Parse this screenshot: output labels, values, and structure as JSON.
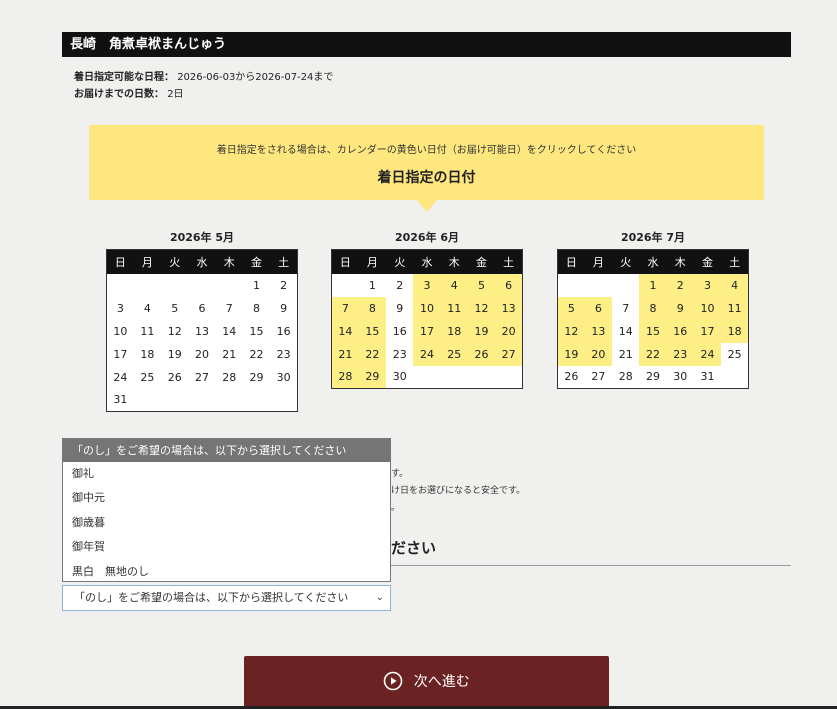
{
  "product_title": "長崎　角煮卓袱まんじゅう",
  "info": {
    "range_label": "着日指定可能な日程：",
    "range_value": "2026-06-03から2026-07-24まで",
    "days_label": "お届けまでの日数：",
    "days_value": "2日"
  },
  "banner": {
    "instruction": "着日指定をされる場合は、カレンダーの黄色い日付（お届け可能日）をクリックしてください",
    "heading": "着日指定の日付"
  },
  "weekday_headers": [
    "日",
    "月",
    "火",
    "水",
    "木",
    "金",
    "土"
  ],
  "calendars": [
    {
      "caption": "2026年 5月",
      "weeks": [
        [
          {
            "d": ""
          },
          {
            "d": ""
          },
          {
            "d": ""
          },
          {
            "d": ""
          },
          {
            "d": ""
          },
          {
            "d": "1"
          },
          {
            "d": "2"
          }
        ],
        [
          {
            "d": "3"
          },
          {
            "d": "4"
          },
          {
            "d": "5"
          },
          {
            "d": "6"
          },
          {
            "d": "7"
          },
          {
            "d": "8"
          },
          {
            "d": "9"
          }
        ],
        [
          {
            "d": "10"
          },
          {
            "d": "11"
          },
          {
            "d": "12"
          },
          {
            "d": "13"
          },
          {
            "d": "14"
          },
          {
            "d": "15"
          },
          {
            "d": "16"
          }
        ],
        [
          {
            "d": "17"
          },
          {
            "d": "18"
          },
          {
            "d": "19"
          },
          {
            "d": "20"
          },
          {
            "d": "21"
          },
          {
            "d": "22"
          },
          {
            "d": "23"
          }
        ],
        [
          {
            "d": "24"
          },
          {
            "d": "25"
          },
          {
            "d": "26"
          },
          {
            "d": "27"
          },
          {
            "d": "28"
          },
          {
            "d": "29"
          },
          {
            "d": "30"
          }
        ],
        [
          {
            "d": "31"
          },
          {
            "d": ""
          },
          {
            "d": ""
          },
          {
            "d": ""
          },
          {
            "d": ""
          },
          {
            "d": ""
          },
          {
            "d": ""
          }
        ]
      ]
    },
    {
      "caption": "2026年 6月",
      "weeks": [
        [
          {
            "d": ""
          },
          {
            "d": "1"
          },
          {
            "d": "2"
          },
          {
            "d": "3",
            "y": true
          },
          {
            "d": "4",
            "y": true
          },
          {
            "d": "5",
            "y": true
          },
          {
            "d": "6",
            "y": true
          }
        ],
        [
          {
            "d": "7",
            "y": true
          },
          {
            "d": "8",
            "y": true
          },
          {
            "d": "9"
          },
          {
            "d": "10",
            "y": true
          },
          {
            "d": "11",
            "y": true
          },
          {
            "d": "12",
            "y": true
          },
          {
            "d": "13",
            "y": true
          }
        ],
        [
          {
            "d": "14",
            "y": true
          },
          {
            "d": "15",
            "y": true
          },
          {
            "d": "16"
          },
          {
            "d": "17",
            "y": true
          },
          {
            "d": "18",
            "y": true
          },
          {
            "d": "19",
            "y": true
          },
          {
            "d": "20",
            "y": true
          }
        ],
        [
          {
            "d": "21",
            "y": true
          },
          {
            "d": "22",
            "y": true
          },
          {
            "d": "23"
          },
          {
            "d": "24",
            "y": true
          },
          {
            "d": "25",
            "y": true
          },
          {
            "d": "26",
            "y": true
          },
          {
            "d": "27",
            "y": true
          }
        ],
        [
          {
            "d": "28",
            "y": true
          },
          {
            "d": "29",
            "y": true
          },
          {
            "d": "30"
          },
          {
            "d": ""
          },
          {
            "d": ""
          },
          {
            "d": ""
          },
          {
            "d": ""
          }
        ]
      ]
    },
    {
      "caption": "2026年 7月",
      "weeks": [
        [
          {
            "d": ""
          },
          {
            "d": ""
          },
          {
            "d": ""
          },
          {
            "d": "1",
            "y": true
          },
          {
            "d": "2",
            "y": true
          },
          {
            "d": "3",
            "y": true
          },
          {
            "d": "4",
            "y": true
          }
        ],
        [
          {
            "d": "5",
            "y": true
          },
          {
            "d": "6",
            "y": true
          },
          {
            "d": "7"
          },
          {
            "d": "8",
            "y": true
          },
          {
            "d": "9",
            "y": true
          },
          {
            "d": "10",
            "y": true
          },
          {
            "d": "11",
            "y": true
          }
        ],
        [
          {
            "d": "12",
            "y": true
          },
          {
            "d": "13",
            "y": true
          },
          {
            "d": "14"
          },
          {
            "d": "15",
            "y": true
          },
          {
            "d": "16",
            "y": true
          },
          {
            "d": "17",
            "y": true
          },
          {
            "d": "18",
            "y": true
          }
        ],
        [
          {
            "d": "19",
            "y": true
          },
          {
            "d": "20",
            "y": true
          },
          {
            "d": "21"
          },
          {
            "d": "22",
            "y": true
          },
          {
            "d": "23",
            "y": true
          },
          {
            "d": "24",
            "y": true
          },
          {
            "d": "25"
          }
        ],
        [
          {
            "d": "26"
          },
          {
            "d": "27"
          },
          {
            "d": "28"
          },
          {
            "d": "29"
          },
          {
            "d": "30"
          },
          {
            "d": "31"
          },
          {
            "d": ""
          }
        ]
      ]
    }
  ],
  "noshi": {
    "placeholder": "「のし」をご希望の場合は、以下から選択してください",
    "options": [
      "御礼",
      "御中元",
      "御歳暮",
      "御年賀",
      "黒白　無地のし"
    ],
    "selected": "「のし」をご希望の場合は、以下から選択してください"
  },
  "partial_text": {
    "line1": "す。",
    "line2": "け日をお選びになると安全です。",
    "line3": "。",
    "heading": "ださい"
  },
  "next_button": {
    "label": "次へ進む",
    "icon": "play-circle-icon"
  },
  "colors": {
    "title_bar": "#111111",
    "banner": "#fde77e",
    "available_day": "#fdee85",
    "button": "#6b2222"
  }
}
